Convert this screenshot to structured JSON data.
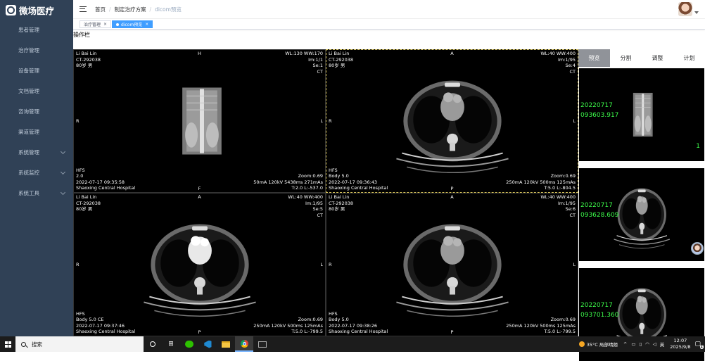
{
  "app": {
    "logo_text": "微场医疗"
  },
  "sidebar": {
    "items": [
      {
        "label": "患者管理",
        "has_children": false
      },
      {
        "label": "治疗管理",
        "has_children": false
      },
      {
        "label": "设备管理",
        "has_children": false
      },
      {
        "label": "文档管理",
        "has_children": false
      },
      {
        "label": "咨询管理",
        "has_children": false
      },
      {
        "label": "渠道管理",
        "has_children": false
      },
      {
        "label": "系统管理",
        "has_children": true
      },
      {
        "label": "系统监控",
        "has_children": true
      },
      {
        "label": "系统工具",
        "has_children": true
      }
    ]
  },
  "header": {
    "breadcrumb": [
      "首页",
      "制定治疗方案",
      "dicom预览"
    ]
  },
  "tags": [
    {
      "label": "治疗管理",
      "active": false
    },
    {
      "label": "dicom预览",
      "active": true
    }
  ],
  "toolbar": {
    "label": "操作栏"
  },
  "viewports": [
    {
      "top_left": [
        "Li Bai Lin",
        "CT-292038",
        "80岁 男"
      ],
      "top_right": [
        "WL:130 WW:170",
        "Im:1/1",
        "Se:1",
        "CT"
      ],
      "bottom_left": [
        "HFS",
        "2.0",
        "2022-07-17 09:35:58",
        "Shaoxing Central Hospital"
      ],
      "bottom_right": [
        "Zoom:0.69",
        "50mA 120kV 5438ms 271mAs",
        "T:2.0 L:-537.0"
      ],
      "orientation": {
        "top": "H",
        "bottom": "F",
        "left": "R",
        "right": "L"
      },
      "image": "scout",
      "active": false
    },
    {
      "top_left": [
        "Li Bai Lin",
        "CT-292038",
        "80岁 男"
      ],
      "top_right": [
        "WL:40 WW:400",
        "Im:1/95",
        "Se:4",
        "CT"
      ],
      "bottom_left": [
        "HFS",
        "Body 5.0",
        "2022-07-17 09:36:43",
        "Shaoxing Central Hospital"
      ],
      "bottom_right": [
        "Zoom:0.69",
        "250mA 120kV 500ms 125mAs",
        "T:5.0 L:-804.5"
      ],
      "orientation": {
        "top": "A",
        "bottom": "P",
        "left": "R",
        "right": "L"
      },
      "image": "axial",
      "active": true
    },
    {
      "top_left": [
        "Li Bai Lin",
        "CT-292038",
        "80岁 男"
      ],
      "top_right": [
        "WL:40 WW:400",
        "Im:1/95",
        "Se:5",
        "CT"
      ],
      "bottom_left": [
        "HFS",
        "Body 5.0 CE",
        "2022-07-17 09:37:46",
        "Shaoxing Central Hospital"
      ],
      "bottom_right": [
        "Zoom:0.69",
        "250mA 120kV 500ms 125mAs",
        "T:5.0 L:-799.5"
      ],
      "orientation": {
        "top": "A",
        "bottom": "P",
        "left": "R",
        "right": "L"
      },
      "image": "axial-contrast",
      "active": false
    },
    {
      "top_left": [
        "Li Bai Lin",
        "CT-292038",
        "80岁 男"
      ],
      "top_right": [
        "WL:40 WW:400",
        "Im:1/95",
        "Se:6",
        "CT"
      ],
      "bottom_left": [
        "HFS",
        "Body 5.0",
        "2022-07-17 09:38:26",
        "Shaoxing Central Hospital"
      ],
      "bottom_right": [
        "Zoom:0.69",
        "250mA 120kV 500ms 125mAs",
        "T:5.0 L:-799.5"
      ],
      "orientation": {
        "top": "A",
        "bottom": "P",
        "left": "R",
        "right": "L"
      },
      "image": "axial",
      "active": false
    }
  ],
  "right_panel": {
    "tabs": [
      {
        "label": "预览",
        "active": true
      },
      {
        "label": "分割",
        "active": false
      },
      {
        "label": "调整",
        "active": false
      },
      {
        "label": "计划",
        "active": false
      }
    ],
    "thumbnails": [
      {
        "date": "20220717",
        "time": "093603.917",
        "count": "1",
        "image": "scout"
      },
      {
        "date": "20220717",
        "time": "093628.609",
        "count": "",
        "image": "axial"
      },
      {
        "date": "20220717",
        "time": "093701.360",
        "count": "",
        "image": "axial"
      }
    ]
  },
  "taskbar": {
    "search_placeholder": "搜索",
    "weather": "35°C 局部晴朗",
    "ime": "英",
    "time": "12:07",
    "date": "2025/9/8",
    "notification_count": "2"
  },
  "colors": {
    "sidebar_bg": "#304156",
    "accent": "#409eff",
    "thumb_text": "#3cfa4a",
    "active_viewport_border": "#d6c35b"
  }
}
